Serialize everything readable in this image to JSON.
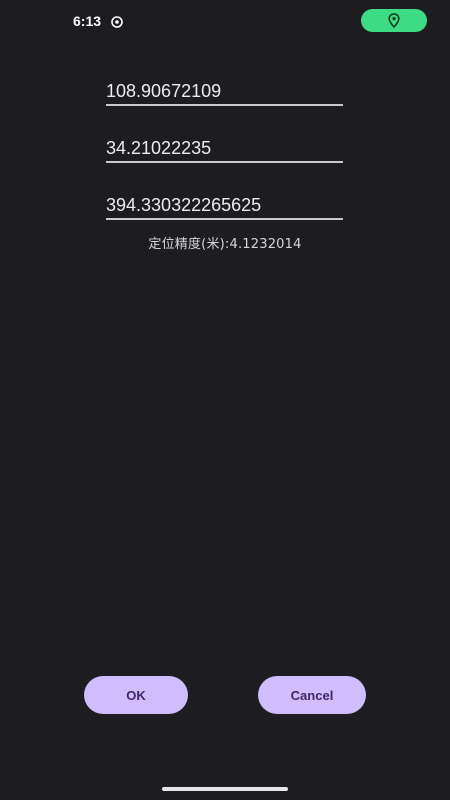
{
  "status_bar": {
    "time": "6:13",
    "visibility_icon": "eye-icon",
    "location_icon": "location-pin-icon",
    "location_pill_color": "#3ddc84"
  },
  "form": {
    "longitude": "108.90672109",
    "latitude": "34.21022235",
    "altitude": "394.330322265625"
  },
  "accuracy_text": "定位精度(米):4.1232014",
  "buttons": {
    "ok_label": "OK",
    "cancel_label": "Cancel"
  },
  "colors": {
    "background": "#1d1c21",
    "button_fill": "#d0bcff",
    "button_text": "#3a2a66"
  }
}
